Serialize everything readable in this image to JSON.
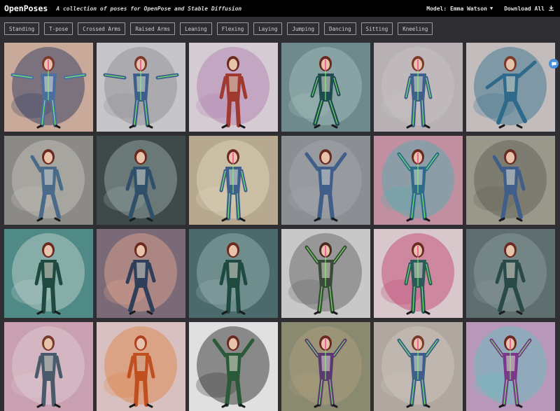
{
  "header": {
    "brand": "OpenPoses",
    "tagline": "A collection of poses for OpenPose and Stable Diffusion",
    "model_label": "Model: Emma Watson",
    "download_label": "Download All"
  },
  "filters": [
    "Standing",
    "T-pose",
    "Crossed Arms",
    "Raised Arms",
    "Leaning",
    "Flexing",
    "Laying",
    "Jumping",
    "Dancing",
    "Sitting",
    "Kneeling"
  ],
  "colors": {
    "topbar_bg": "#000000",
    "page_bg": "#2f2f33",
    "chip_border": "#9a9aa0",
    "accent_badge": "#4a90d9"
  },
  "gallery": [
    {
      "bg": "#c9a99a",
      "accent": "#1f2f5a",
      "fig": "#4d6fa0",
      "hair": "#7a3a2a",
      "pose": "tpose",
      "skeleton": true
    },
    {
      "bg": "#c6c6c9",
      "accent": "#8a8a90",
      "fig": "#3f5f8a",
      "hair": "#7a3a2a",
      "pose": "tpose",
      "skeleton": true
    },
    {
      "bg": "#d4ccd2",
      "accent": "#b07ab0",
      "fig": "#a03a30",
      "hair": "#6a2a20",
      "pose": "stand",
      "skeleton": false
    },
    {
      "bg": "#6f8a8c",
      "accent": "#a7c2bf",
      "fig": "#1f4a50",
      "hair": "#6a2a20",
      "pose": "walk",
      "skeleton": true
    },
    {
      "bg": "#b7b1b3",
      "accent": "#c9c4c6",
      "fig": "#3f5f8a",
      "hair": "#7a3a2a",
      "pose": "stand",
      "skeleton": true
    },
    {
      "bg": "#c2bdbc",
      "accent": "#2f6a8a",
      "fig": "#2f6a8a",
      "hair": "#7a3a2a",
      "pose": "dance",
      "skeleton": false
    },
    {
      "bg": "#8b8a86",
      "accent": "#c9c6c0",
      "fig": "#4a6a8a",
      "hair": "#6a2a20",
      "pose": "lean",
      "skeleton": false
    },
    {
      "bg": "#3e4a4a",
      "accent": "#9fb2b0",
      "fig": "#2f4f6a",
      "hair": "#6a2a20",
      "pose": "walk",
      "skeleton": false
    },
    {
      "bg": "#b7a98f",
      "accent": "#e3d6bf",
      "fig": "#3f5f8a",
      "hair": "#6a2a20",
      "pose": "stand",
      "skeleton": true
    },
    {
      "bg": "#8b8f94",
      "accent": "#a7abb0",
      "fig": "#3f5f8a",
      "hair": "#6a2a20",
      "pose": "raise",
      "skeleton": false
    },
    {
      "bg": "#c08fa0",
      "accent": "#4fb0b0",
      "fig": "#2f6a8a",
      "hair": "#6a2a20",
      "pose": "raise",
      "skeleton": true
    },
    {
      "bg": "#9a988a",
      "accent": "#5a5a50",
      "fig": "#3f5f8a",
      "hair": "#6a2a20",
      "pose": "lean",
      "skeleton": false
    },
    {
      "bg": "#4f8a86",
      "accent": "#c9d6d2",
      "fig": "#1f4a40",
      "hair": "#6a2a20",
      "pose": "stand",
      "skeleton": false
    },
    {
      "bg": "#7a6a78",
      "accent": "#e8a890",
      "fig": "#2f3f5a",
      "hair": "#6a2a20",
      "pose": "walk",
      "skeleton": false
    },
    {
      "bg": "#4a6a6c",
      "accent": "#9fb8b8",
      "fig": "#1f4a40",
      "hair": "#6a2a20",
      "pose": "stand",
      "skeleton": false
    },
    {
      "bg": "#c8c8c8",
      "accent": "#5a5a5a",
      "fig": "#3a4a3a",
      "hair": "#4a2a20",
      "pose": "raise",
      "skeleton": true
    },
    {
      "bg": "#d8c8cc",
      "accent": "#c03a6a",
      "fig": "#2a5a5a",
      "hair": "#6a2a20",
      "pose": "stand",
      "skeleton": true
    },
    {
      "bg": "#5f6f6f",
      "accent": "#8fa0a0",
      "fig": "#2a4a4a",
      "hair": "#6a2a20",
      "pose": "walk",
      "skeleton": false
    },
    {
      "bg": "#c8a0b0",
      "accent": "#e0d0d8",
      "fig": "#4a5a6a",
      "hair": "#7a3a2a",
      "pose": "stand",
      "skeleton": false
    },
    {
      "bg": "#d8c0c0",
      "accent": "#e08040",
      "fig": "#c05020",
      "hair": "#b04020",
      "pose": "stand",
      "skeleton": false
    },
    {
      "bg": "#e0e0e0",
      "accent": "#202020",
      "fig": "#2a5a3a",
      "hair": "#6a2a20",
      "pose": "raise",
      "skeleton": false
    },
    {
      "bg": "#8a8a70",
      "accent": "#b0a080",
      "fig": "#5a3a70",
      "hair": "#6a2a20",
      "pose": "raise",
      "skeleton": true
    },
    {
      "bg": "#b0a8a0",
      "accent": "#d0c8c0",
      "fig": "#3f5f8a",
      "hair": "#7a3a2a",
      "pose": "raise",
      "skeleton": true
    },
    {
      "bg": "#b898b8",
      "accent": "#60c0c0",
      "fig": "#7a3a8a",
      "hair": "#6a2a20",
      "pose": "raise",
      "skeleton": true
    }
  ]
}
